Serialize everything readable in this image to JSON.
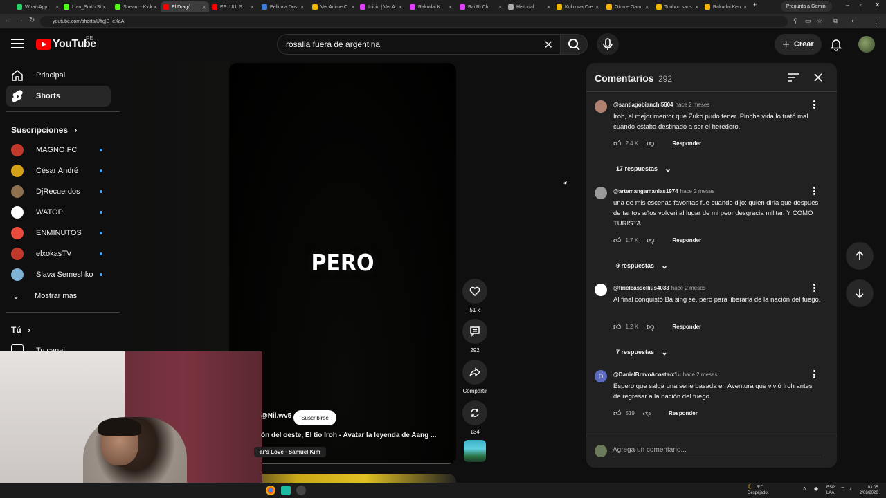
{
  "browser": {
    "tabs": [
      {
        "label": "WhatsApp",
        "color": "#25d366"
      },
      {
        "label": "Lian_Sorth St",
        "color": "#53fc18"
      },
      {
        "label": "Stream - Kick",
        "color": "#53fc18"
      },
      {
        "label": "El Dragó",
        "color": "#ff0000",
        "active": true
      },
      {
        "label": "EE. UU. S",
        "color": "#ff0000"
      },
      {
        "label": "Película Dos",
        "color": "#3a7bd5"
      },
      {
        "label": "Ver Anime O",
        "color": "#f4b400"
      },
      {
        "label": "Inicio | Ver A",
        "color": "#e040fb"
      },
      {
        "label": "Rakudai K",
        "color": "#e040fb"
      },
      {
        "label": "Bai Ri Chr",
        "color": "#e040fb"
      },
      {
        "label": "Historial",
        "color": "#aaaaaa"
      },
      {
        "label": "Koko wa Ore",
        "color": "#f4b400"
      },
      {
        "label": "Otome Gam",
        "color": "#f4b400"
      },
      {
        "label": "Touhou sans",
        "color": "#f4b400"
      },
      {
        "label": "Rakudai Ken",
        "color": "#f4b400"
      }
    ],
    "gemini_label": "Pregunta a Gemini",
    "url": "youtube.com/shorts/Uftg|B_eXaA"
  },
  "header": {
    "logo_text": "YouTube",
    "country_code": "PE",
    "search_value": "rosalia fuera de argentina",
    "create_label": "Crear"
  },
  "sidebar": {
    "main": [
      {
        "label": "Principal",
        "icon": "home-icon"
      },
      {
        "label": "Shorts",
        "icon": "shorts-icon",
        "active": true
      }
    ],
    "subscriptions_title": "Suscripciones",
    "subscriptions": [
      {
        "label": "MAGNO FC",
        "color": "#c0392b"
      },
      {
        "label": "César André",
        "color": "#d4a017"
      },
      {
        "label": "DjRecuerdos",
        "color": "#8e6f4e"
      },
      {
        "label": "WATOP",
        "color": "#ffffff"
      },
      {
        "label": "ENMINUTOS",
        "color": "#e74c3c"
      },
      {
        "label": "elxokasTV",
        "color": "#c0392b"
      },
      {
        "label": "Slava Semeshko",
        "color": "#7fb3d5"
      }
    ],
    "show_more_label": "Mostrar más",
    "you_title": "Tú",
    "your_channel_label": "Tu canal"
  },
  "video": {
    "overlay_text": "PERO",
    "channel": "@Nil.wv5",
    "subscribe_label": "Suscribirse",
    "title": "ón del oeste, El tío Iroh - Avatar la leyenda de Aang ...",
    "music": "ar's Love · Samuel Kim"
  },
  "actions": {
    "likes": "51 k",
    "comments": "292",
    "share_label": "Compartir",
    "remix": "134"
  },
  "comments": {
    "title": "Comentarios",
    "count": "292",
    "items": [
      {
        "author": "@santiagobianchi5604",
        "time": "hace 2 meses",
        "text": "Iroh, el mejor mentor que Zuko pudo tener. Pinche vida lo trató mal cuando estaba destinado a ser el heredero.",
        "likes": "2.4 K",
        "reply_label": "Responder",
        "replies": "17 respuestas",
        "avatar_color": "#b08070"
      },
      {
        "author": "@artemangamanias1974",
        "time": "hace 2 meses",
        "text": "una de mis escenas favoritas fue cuando dijo: quien diria que despues de tantos años volveri al lugar de mi peor desgracia militar, Y COMO TURISTA",
        "likes": "1.7 K",
        "reply_label": "Responder",
        "replies": "9 respuestas",
        "avatar_color": "#9a9a9a"
      },
      {
        "author": "@firielcassellius4033",
        "time": "hace 2 meses",
        "text": "Al final conquistó Ba sing se, pero para liberarla de la nación del fuego.",
        "likes": "1.2 K",
        "reply_label": "Responder",
        "replies": "7 respuestas",
        "avatar_color": "#ffffff"
      },
      {
        "author": "@DanielBravoAcosta-x1u",
        "time": "hace 2 meses",
        "text": "Espero que salga una serie basada en Aventura que vivió Iroh antes de regresar a la nación del fuego.",
        "likes": "519",
        "reply_label": "Responder",
        "avatar_letter": "D",
        "avatar_color": "#5c6bc0"
      }
    ],
    "input_placeholder": "Agrega un comentario..."
  },
  "taskbar": {
    "weather_temp": "5°C",
    "weather_desc": "Despejado",
    "lang_1": "ESP",
    "lang_2": "LAA",
    "time": "03:05",
    "date": "2/08/2026"
  }
}
